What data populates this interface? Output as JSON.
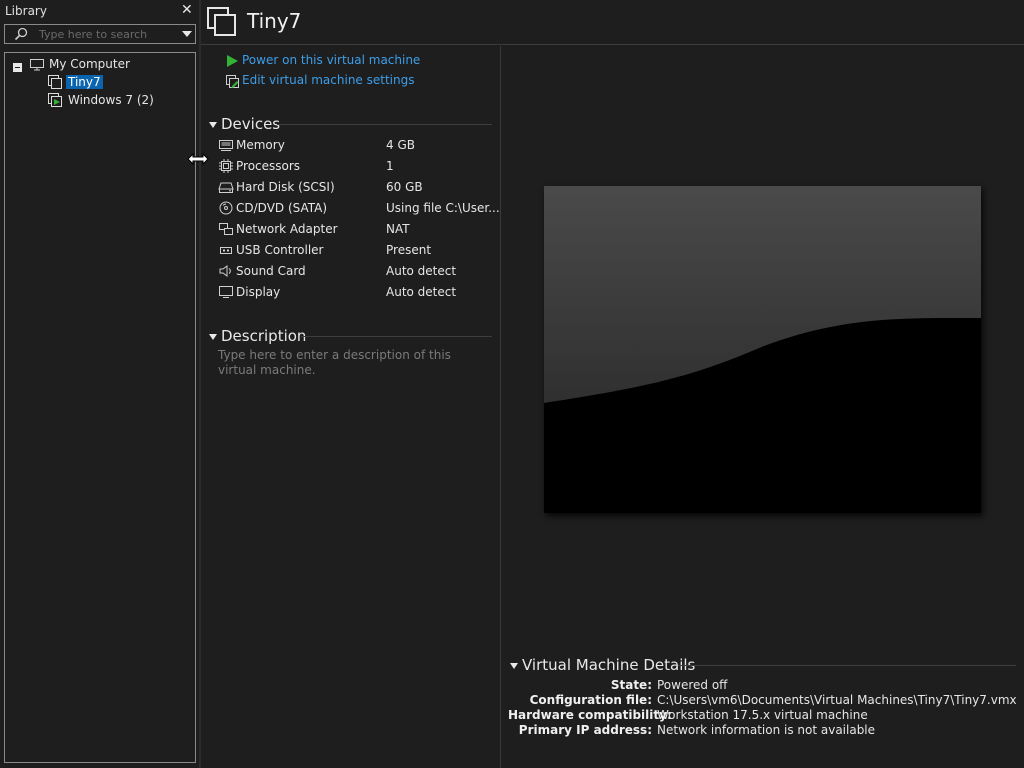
{
  "library": {
    "title": "Library",
    "close_glyph": "✕",
    "search_placeholder": "Type here to search",
    "tree": {
      "root_label": "My Computer",
      "items": [
        {
          "label": "Tiny7",
          "selected": true
        },
        {
          "label": "Windows 7 (2)",
          "selected": false
        }
      ]
    }
  },
  "vm": {
    "title": "Tiny7",
    "actions": {
      "power_on": "Power on this virtual machine",
      "edit_settings": "Edit virtual machine settings"
    },
    "devices_heading": "Devices",
    "devices": [
      {
        "name": "Memory",
        "value": "4 GB",
        "icon": "memory-icon"
      },
      {
        "name": "Processors",
        "value": "1",
        "icon": "processor-icon"
      },
      {
        "name": "Hard Disk (SCSI)",
        "value": "60 GB",
        "icon": "hard-disk-icon"
      },
      {
        "name": "CD/DVD (SATA)",
        "value": "Using file C:\\User...",
        "icon": "cd-dvd-icon"
      },
      {
        "name": "Network Adapter",
        "value": "NAT",
        "icon": "network-adapter-icon"
      },
      {
        "name": "USB Controller",
        "value": "Present",
        "icon": "usb-controller-icon"
      },
      {
        "name": "Sound Card",
        "value": "Auto detect",
        "icon": "sound-card-icon"
      },
      {
        "name": "Display",
        "value": "Auto detect",
        "icon": "display-icon"
      }
    ],
    "description_heading": "Description",
    "description_placeholder": "Type here to enter a description of this virtual machine.",
    "details_heading": "Virtual Machine Details",
    "details": {
      "state_label": "State:",
      "state_value": "Powered off",
      "config_label": "Configuration file:",
      "config_value": "C:\\Users\\vm6\\Documents\\Virtual Machines\\Tiny7\\Tiny7.vmx",
      "hw_label": "Hardware compatibility:",
      "hw_value": "Workstation 17.5.x virtual machine",
      "ip_label": "Primary IP address:",
      "ip_value": "Network information is not available"
    }
  },
  "colors": {
    "background": "#1e1e1e",
    "link": "#3d9ee8",
    "selection": "#0a64b0",
    "play_green": "#34b233"
  }
}
